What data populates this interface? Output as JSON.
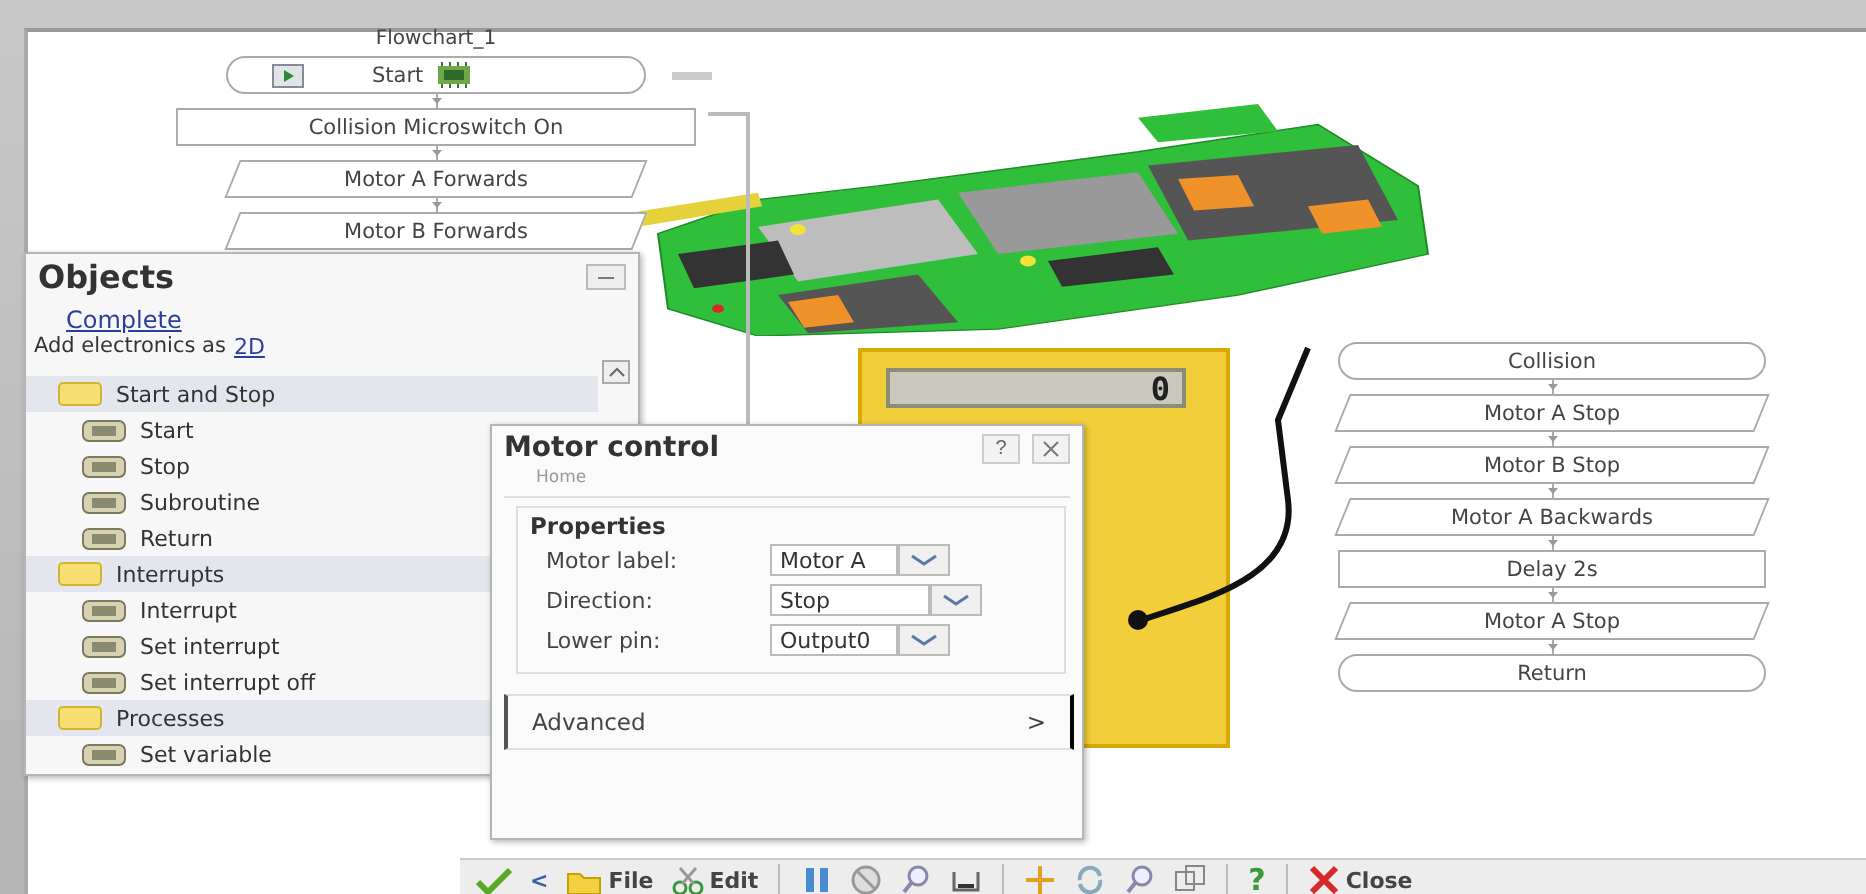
{
  "flowchart_main": {
    "title": "Flowchart_1",
    "blocks": [
      {
        "kind": "start",
        "label": "Start"
      },
      {
        "kind": "process",
        "label": "Collision Microswitch On"
      },
      {
        "kind": "io",
        "label": "Motor A Forwards"
      },
      {
        "kind": "io",
        "label": "Motor B Forwards"
      }
    ]
  },
  "multimeter": {
    "reading": "0"
  },
  "flowchart_sub": {
    "blocks": [
      {
        "kind": "terminator",
        "label": "Collision"
      },
      {
        "kind": "io",
        "label": "Motor A Stop"
      },
      {
        "kind": "io",
        "label": "Motor B Stop"
      },
      {
        "kind": "io",
        "label": "Motor A Backwards"
      },
      {
        "kind": "process",
        "label": "Delay 2s"
      },
      {
        "kind": "io",
        "label": "Motor A Stop"
      },
      {
        "kind": "terminator",
        "label": "Return"
      }
    ]
  },
  "objects_panel": {
    "title": "Objects",
    "link": "Complete",
    "add_text": "Add electronics as",
    "add_link": "2D",
    "categories": [
      {
        "label": "Start and Stop",
        "children": [
          {
            "label": "Start"
          },
          {
            "label": "Stop"
          },
          {
            "label": "Subroutine"
          },
          {
            "label": "Return"
          }
        ]
      },
      {
        "label": "Interrupts",
        "children": [
          {
            "label": "Interrupt"
          },
          {
            "label": "Set interrupt"
          },
          {
            "label": "Set interrupt off"
          }
        ]
      },
      {
        "label": "Processes",
        "children": [
          {
            "label": "Set variable"
          }
        ]
      }
    ]
  },
  "motor_dialog": {
    "title": "Motor control",
    "help": "?",
    "breadcrumb": "Home",
    "group_title": "Properties",
    "fields": [
      {
        "label": "Motor label:",
        "value": "Motor A"
      },
      {
        "label": "Direction:",
        "value": "Stop"
      },
      {
        "label": "Lower pin:",
        "value": "Output0"
      }
    ],
    "advanced": {
      "label": "Advanced",
      "arrow": ">"
    }
  },
  "toolbar": {
    "back": "<",
    "file": "File",
    "edit": "Edit",
    "help": "?",
    "close": "Close"
  }
}
